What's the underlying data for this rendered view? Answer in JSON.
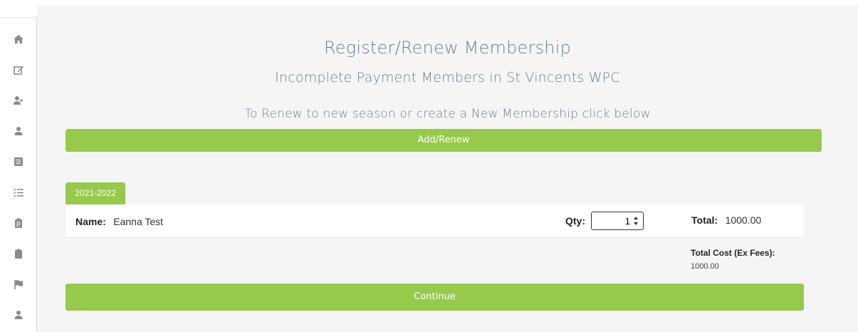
{
  "sidebar": {
    "icons": [
      "home-icon",
      "edit-icon",
      "add-user-icon",
      "user-icon",
      "list-box-icon",
      "checklist-icon",
      "clipboard-icon",
      "clipboard-alt-icon",
      "flag-icon",
      "profile-icon"
    ]
  },
  "header": {
    "title": "Register/Renew Membership",
    "subtitle": "Incomplete Payment Members in St Vincents WPC",
    "instruction": "To Renew to new season or create a New Membership click below"
  },
  "buttons": {
    "add_renew": "Add/Renew",
    "continue": "Continue"
  },
  "season": {
    "tab_label": "2021-2022"
  },
  "member": {
    "name_label": "Name:",
    "name": "Eanna Test",
    "qty_label": "Qty:",
    "qty": "1",
    "total_label": "Total:",
    "total": "1000.00"
  },
  "summary": {
    "total_cost_label": "Total Cost (Ex Fees):",
    "total_cost": "1000.00"
  },
  "colors": {
    "accent_green": "#96c94c",
    "heading_blue": "#6b7f99",
    "sidebar_icon": "#8a8a8a"
  }
}
